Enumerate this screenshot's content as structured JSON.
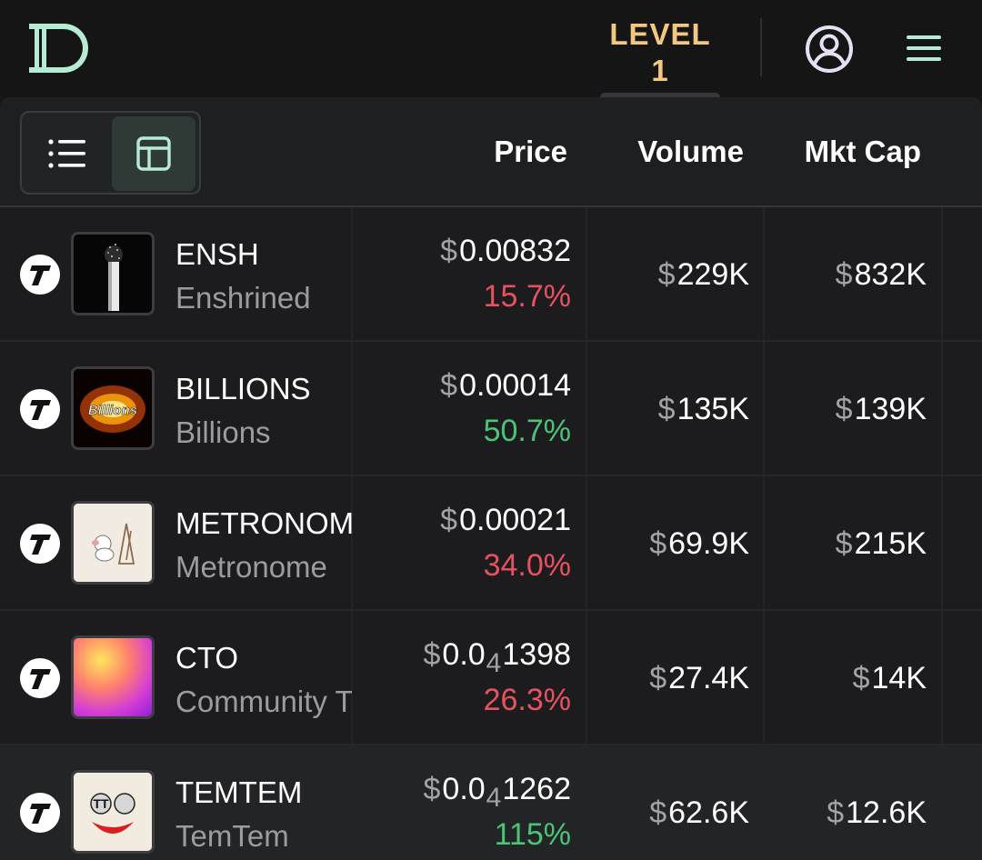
{
  "header": {
    "level_label": "LEVEL 1",
    "logo_icon": "brand-logo-icon",
    "user_icon": "user-circle-icon",
    "menu_icon": "hamburger-menu-icon",
    "accent_color": "#f3c77f",
    "brand_color": "#b6ecd5"
  },
  "table": {
    "view_toggle": {
      "list_icon": "list-view-icon",
      "grid_icon": "table-view-icon",
      "active": "grid"
    },
    "columns": {
      "price": "Price",
      "volume": "Volume",
      "mkt_cap": "Mkt Cap"
    },
    "currency_symbol": "$",
    "rows": [
      {
        "chain_icon": "t-chain-icon",
        "image": "ensh-thumbnail",
        "symbol": "ENSH",
        "name": "Enshrined",
        "price": "0.00832",
        "price_prefix": "",
        "price_zero_count": "",
        "price_suffix": "",
        "change": "15.7%",
        "change_dir": "down",
        "volume": "229K",
        "mkt_cap": "832K"
      },
      {
        "chain_icon": "t-chain-icon",
        "image": "billions-thumbnail",
        "image_text": "Billions",
        "symbol": "BILLIONS",
        "name": "Billions",
        "price": "0.00014",
        "price_prefix": "",
        "price_zero_count": "",
        "price_suffix": "",
        "change": "50.7%",
        "change_dir": "up",
        "volume": "135K",
        "mkt_cap": "139K"
      },
      {
        "chain_icon": "t-chain-icon",
        "image": "metronome-thumbnail",
        "symbol": "METRONOME",
        "name": "Metronome",
        "price": "0.00021",
        "price_prefix": "",
        "price_zero_count": "",
        "price_suffix": "",
        "change": "34.0%",
        "change_dir": "down",
        "volume": "69.9K",
        "mkt_cap": "215K"
      },
      {
        "chain_icon": "t-chain-icon",
        "image": "cto-thumbnail",
        "symbol": "CTO",
        "name": "Community T",
        "price": "",
        "price_prefix": "0.0",
        "price_zero_count": "4",
        "price_suffix": "1398",
        "change": "26.3%",
        "change_dir": "down",
        "volume": "27.4K",
        "mkt_cap": "14K"
      },
      {
        "chain_icon": "t-chain-icon",
        "image": "temtem-thumbnail",
        "image_text": "TT",
        "symbol": "TEMTEM",
        "name": "TemTem",
        "price": "",
        "price_prefix": "0.0",
        "price_zero_count": "4",
        "price_suffix": "1262",
        "change": "115%",
        "change_dir": "up",
        "volume": "62.6K",
        "mkt_cap": "12.6K"
      }
    ],
    "colors": {
      "negative": "#e6525f",
      "positive": "#4cc478"
    }
  }
}
